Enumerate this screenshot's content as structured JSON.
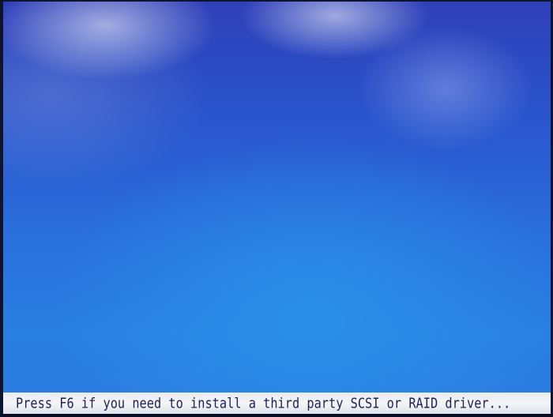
{
  "setup_screen": {
    "status_bar": {
      "message": "Press F6 if you need to install a third party SCSI or RAID driver..."
    }
  }
}
